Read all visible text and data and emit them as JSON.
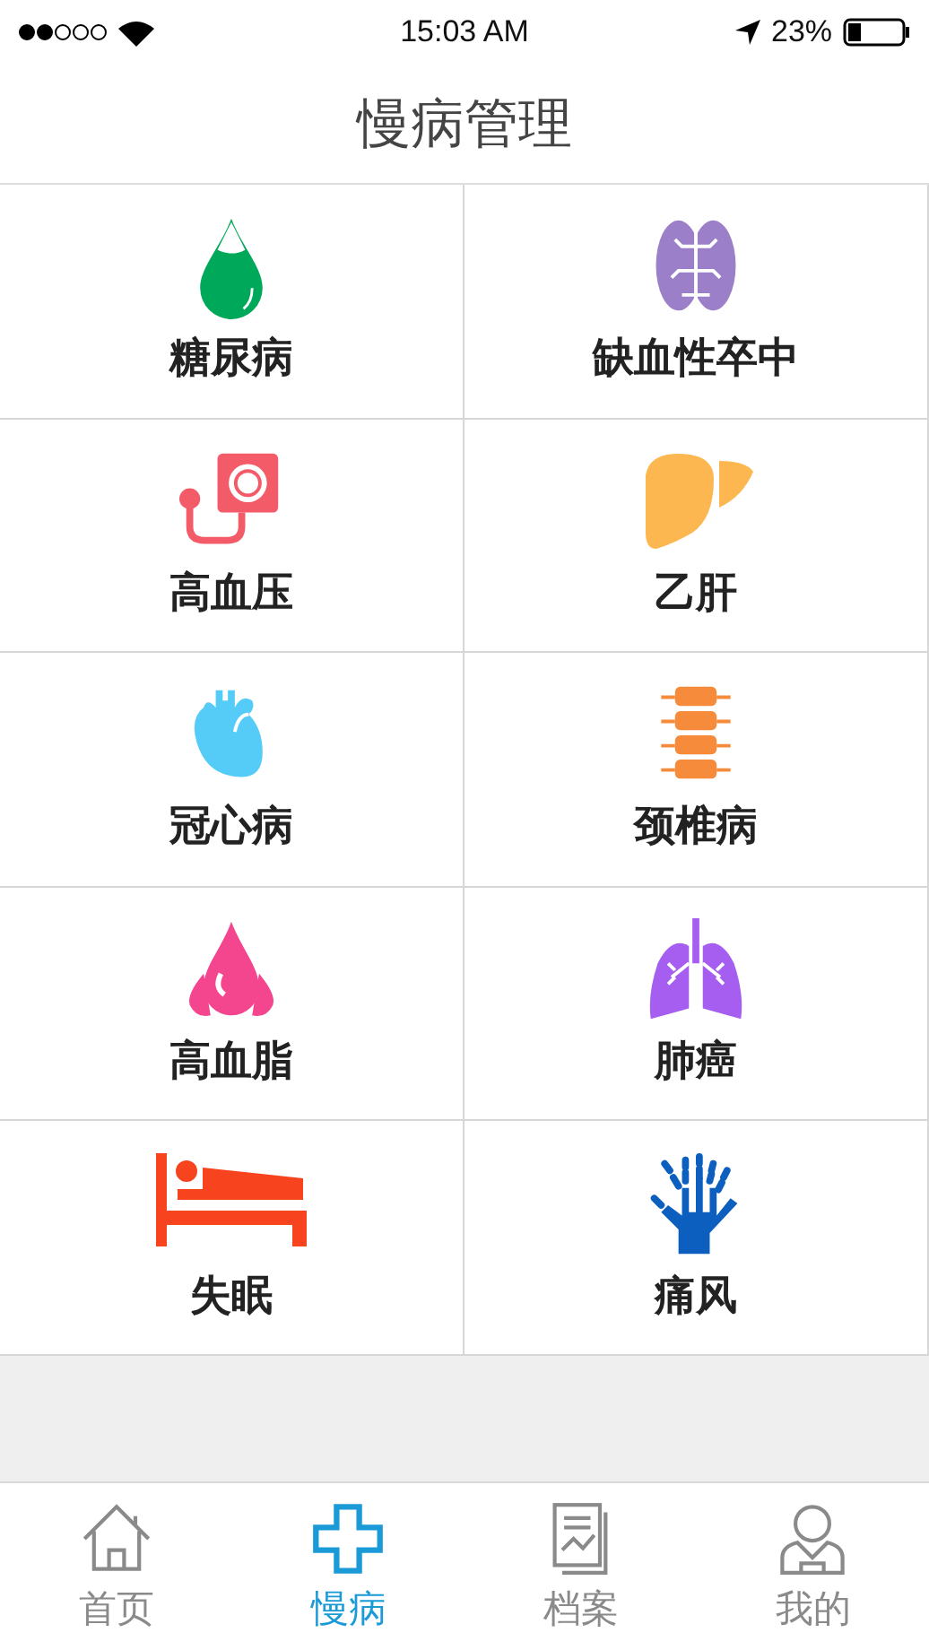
{
  "status_bar": {
    "time": "15:03 AM",
    "battery": "23%"
  },
  "title": "慢病管理",
  "diseases": [
    {
      "label": "糖尿病",
      "kind": "drop",
      "color": "#00a85a"
    },
    {
      "label": "缺血性卒中",
      "kind": "brain",
      "color": "#9b7fc8"
    },
    {
      "label": "高血压",
      "kind": "meter",
      "color": "#f45b69"
    },
    {
      "label": "乙肝",
      "kind": "liver",
      "color": "#fdb750"
    },
    {
      "label": "冠心病",
      "kind": "heart",
      "color": "#55ccf7"
    },
    {
      "label": "颈椎病",
      "kind": "spine",
      "color": "#f68b3c"
    },
    {
      "label": "高血脂",
      "kind": "drops",
      "color": "#f4468f"
    },
    {
      "label": "肺癌",
      "kind": "lungs",
      "color": "#a55ef0"
    },
    {
      "label": "失眠",
      "kind": "bed",
      "color": "#f8431f"
    },
    {
      "label": "痛风",
      "kind": "hand",
      "color": "#0c5fbf"
    }
  ],
  "tabs": [
    {
      "label": "首页",
      "kind": "home",
      "selected": false
    },
    {
      "label": "慢病",
      "kind": "cross",
      "selected": true
    },
    {
      "label": "档案",
      "kind": "record",
      "selected": false
    },
    {
      "label": "我的",
      "kind": "user",
      "selected": false
    }
  ]
}
